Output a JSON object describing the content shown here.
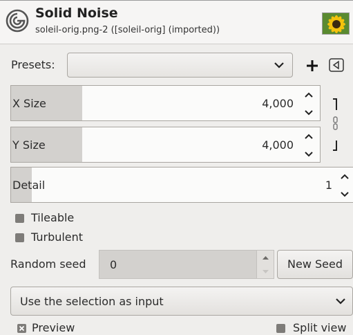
{
  "header": {
    "title": "Solid Noise",
    "subtitle": "soleil-orig.png-2 ([soleil-orig] (imported))",
    "logo_icon": "gegl-swirl-icon",
    "thumbnail_icon": "image-thumbnail"
  },
  "presets": {
    "label": "Presets:",
    "value": "",
    "add_icon": "plus-icon",
    "menu_icon": "triangle-left-icon"
  },
  "x_size": {
    "label": "X Size",
    "value": "4,000",
    "fill_fraction": 0.23
  },
  "y_size": {
    "label": "Y Size",
    "value": "4,000",
    "fill_fraction": 0.23
  },
  "chain_icon": "chain-link-icon",
  "detail": {
    "label": "Detail",
    "value": "1",
    "fill_fraction": 0.06
  },
  "tileable": {
    "label": "Tileable",
    "checked": false
  },
  "turbulent": {
    "label": "Turbulent",
    "checked": false
  },
  "random_seed": {
    "label": "Random seed",
    "value": "0",
    "new_seed_label": "New Seed"
  },
  "input_mode": {
    "value": "Use the selection as input"
  },
  "preview": {
    "label": "Preview",
    "checked": true
  },
  "split_view": {
    "label": "Split view",
    "checked": false
  }
}
